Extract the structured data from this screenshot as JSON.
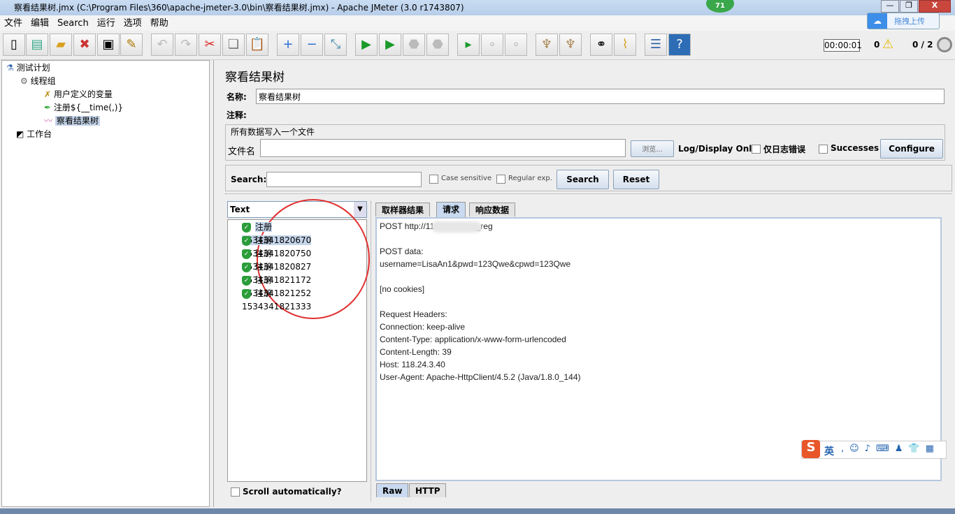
{
  "window": {
    "title": "察看结果树.jmx (C:\\Program Files\\360\\apache-jmeter-3.0\\bin\\察看结果树.jmx) - Apache JMeter (3.0 r1743807)",
    "badge": "71",
    "upload_label": "拖拽上传"
  },
  "menu": [
    "文件",
    "编辑",
    "Search",
    "运行",
    "选项",
    "帮助"
  ],
  "toolbar": {
    "icons": [
      "new-icon",
      "templates-icon",
      "open-icon",
      "close-icon",
      "save-icon",
      "save-as-icon",
      "undo-icon",
      "redo-icon",
      "cut-icon",
      "copy-icon",
      "paste-icon",
      "expand-icon",
      "collapse-icon",
      "toggle-icon",
      "start-icon",
      "start-no-timers-icon",
      "stop-icon",
      "shutdown-icon",
      "remote-start-icon",
      "remote-stop-icon",
      "remote-shutdown-icon",
      "clear-icon",
      "clear-all-icon",
      "search-icon",
      "reset-search-icon",
      "function-helper-icon",
      "help-icon"
    ],
    "timer": "00:00:01",
    "warnings": "0",
    "threads": "0 / 2"
  },
  "tree": {
    "items": [
      {
        "label": "测试计划"
      },
      {
        "label": "线程组"
      },
      {
        "label": "用户定义的变量"
      },
      {
        "label": "注册${__time(,)}"
      },
      {
        "label": "察看结果树",
        "selected": true
      },
      {
        "label": "工作台"
      }
    ]
  },
  "panel": {
    "title": "察看结果树",
    "name_label": "名称:",
    "name_value": "察看结果树",
    "comment_label": "注释:",
    "file_group": "所有数据写入一个文件",
    "file_label": "文件名",
    "file_value": "",
    "browse": "浏览...",
    "log_only": "Log/Display Only:",
    "errors_only": "仅日志错误",
    "successes": "Successes",
    "configure": "Configure"
  },
  "search": {
    "label": "Search:",
    "value": "",
    "case_sensitive": "Case sensitive",
    "regex": "Regular exp.",
    "search_btn": "Search",
    "reset_btn": "Reset"
  },
  "renderer": {
    "selected": "Text"
  },
  "results": [
    "注册1534341820670",
    "注册1534341820750",
    "注册1534341820827",
    "注册1534341821172",
    "注册1534341821252",
    "注册1534341821333"
  ],
  "scroll_auto": "Scroll automatically?",
  "tabs": [
    {
      "label": "取样器结果"
    },
    {
      "label": "请求",
      "active": true
    },
    {
      "label": "响应数据"
    }
  ],
  "request_lines": [
    "POST http://11          i/user/user_reg",
    "",
    "POST data:",
    "username=LisaAn1&pwd=123Qwe&cpwd=123Qwe",
    "",
    "[no cookies]",
    "",
    "Request Headers:",
    "Connection: keep-alive",
    "Content-Type: application/x-www-form-urlencoded",
    "Content-Length: 39",
    "Host: 118.24.3.40",
    "User-Agent: Apache-HttpClient/4.5.2 (Java/1.8.0_144)"
  ],
  "bottom_tabs": [
    "Raw",
    "HTTP"
  ],
  "ime": {
    "mode": "英"
  },
  "colors": {
    "selection": "#c5d5ea",
    "annotation_circle": "#e03030"
  }
}
